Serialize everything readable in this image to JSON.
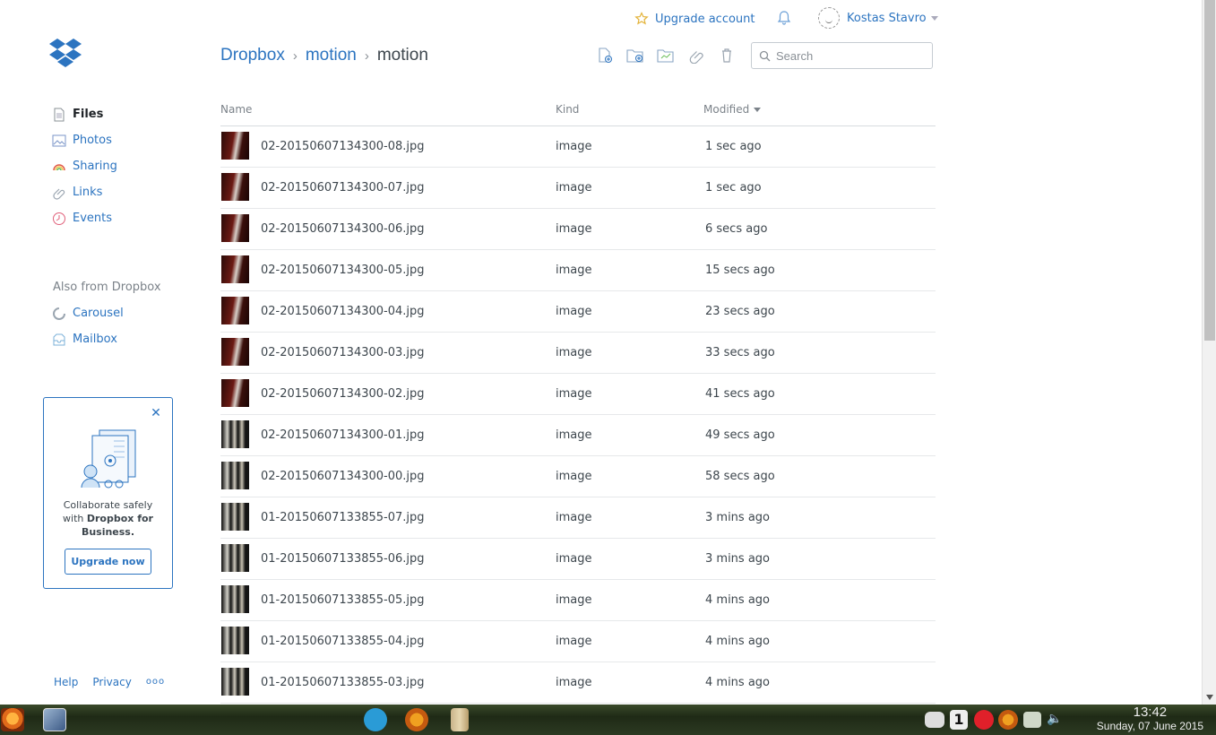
{
  "header": {
    "upgrade_label": "Upgrade account",
    "user_name": "Kostas Stavro"
  },
  "breadcrumb": {
    "root": "Dropbox",
    "parent": "motion",
    "current": "motion"
  },
  "search": {
    "placeholder": "Search"
  },
  "sidebar": {
    "items": [
      {
        "label": "Files",
        "icon": "files-icon"
      },
      {
        "label": "Photos",
        "icon": "photos-icon"
      },
      {
        "label": "Sharing",
        "icon": "sharing-icon"
      },
      {
        "label": "Links",
        "icon": "links-icon"
      },
      {
        "label": "Events",
        "icon": "events-icon"
      }
    ],
    "also_heading": "Also from Dropbox",
    "also_items": [
      {
        "label": "Carousel",
        "icon": "carousel-icon"
      },
      {
        "label": "Mailbox",
        "icon": "mailbox-icon"
      }
    ]
  },
  "promo": {
    "text_1": "Collaborate safely with",
    "text_bold": "Dropbox for Business.",
    "button": "Upgrade now"
  },
  "footer": {
    "help": "Help",
    "privacy": "Privacy",
    "more": "ooo"
  },
  "table": {
    "columns": {
      "name": "Name",
      "kind": "Kind",
      "modified": "Modified"
    },
    "rows": [
      {
        "name": "02-20150607134300-08.jpg",
        "kind": "image",
        "modified": "1 sec ago",
        "thumb": "red"
      },
      {
        "name": "02-20150607134300-07.jpg",
        "kind": "image",
        "modified": "1 sec ago",
        "thumb": "red"
      },
      {
        "name": "02-20150607134300-06.jpg",
        "kind": "image",
        "modified": "6 secs ago",
        "thumb": "red"
      },
      {
        "name": "02-20150607134300-05.jpg",
        "kind": "image",
        "modified": "15 secs ago",
        "thumb": "red"
      },
      {
        "name": "02-20150607134300-04.jpg",
        "kind": "image",
        "modified": "23 secs ago",
        "thumb": "red"
      },
      {
        "name": "02-20150607134300-03.jpg",
        "kind": "image",
        "modified": "33 secs ago",
        "thumb": "red"
      },
      {
        "name": "02-20150607134300-02.jpg",
        "kind": "image",
        "modified": "41 secs ago",
        "thumb": "red"
      },
      {
        "name": "02-20150607134300-01.jpg",
        "kind": "image",
        "modified": "49 secs ago",
        "thumb": "dark"
      },
      {
        "name": "02-20150607134300-00.jpg",
        "kind": "image",
        "modified": "58 secs ago",
        "thumb": "dark"
      },
      {
        "name": "01-20150607133855-07.jpg",
        "kind": "image",
        "modified": "3 mins ago",
        "thumb": "dark"
      },
      {
        "name": "01-20150607133855-06.jpg",
        "kind": "image",
        "modified": "3 mins ago",
        "thumb": "dark"
      },
      {
        "name": "01-20150607133855-05.jpg",
        "kind": "image",
        "modified": "4 mins ago",
        "thumb": "dark"
      },
      {
        "name": "01-20150607133855-04.jpg",
        "kind": "image",
        "modified": "4 mins ago",
        "thumb": "dark"
      },
      {
        "name": "01-20150607133855-03.jpg",
        "kind": "image",
        "modified": "4 mins ago",
        "thumb": "dark"
      }
    ]
  },
  "taskbar": {
    "time": "13:42",
    "date": "Sunday, 07 June 2015",
    "workspace": "1"
  },
  "colors": {
    "accent": "#2c74c0",
    "text": "#3d464d"
  }
}
